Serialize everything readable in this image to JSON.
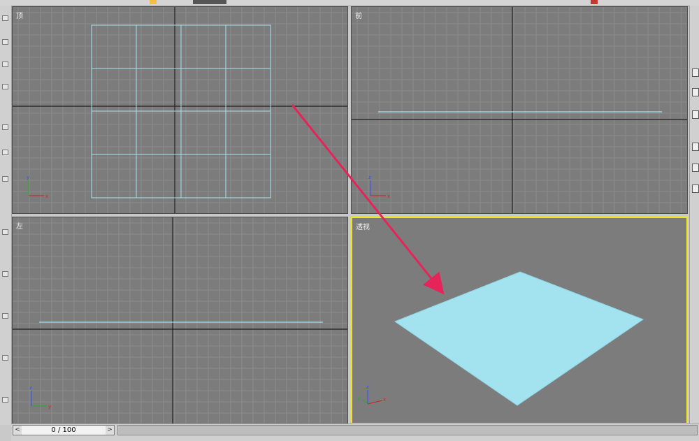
{
  "viewports": [
    {
      "id": "top",
      "label": "顶",
      "axes": [
        "y",
        "x"
      ],
      "active": false
    },
    {
      "id": "front",
      "label": "前",
      "axes": [
        "z",
        "x"
      ],
      "active": false
    },
    {
      "id": "left",
      "label": "左",
      "axes": [
        "z",
        "y"
      ],
      "active": false
    },
    {
      "id": "perspective",
      "label": "透视",
      "axes": [
        "z",
        "y",
        "x"
      ],
      "active": true
    }
  ],
  "timeline": {
    "current": "0",
    "separator": "/",
    "total": "100"
  },
  "colors": {
    "viewport_bg": "#7c7c7c",
    "grid": "#8c8c8c",
    "axis_line": "#1e1e1e",
    "plane": "#a3e3f0",
    "active_border": "#f2e61a",
    "arrow": "#e5245a"
  },
  "icons": [
    "left-arrow-icon",
    "right-arrow-icon",
    "axis-tripod-icon"
  ]
}
